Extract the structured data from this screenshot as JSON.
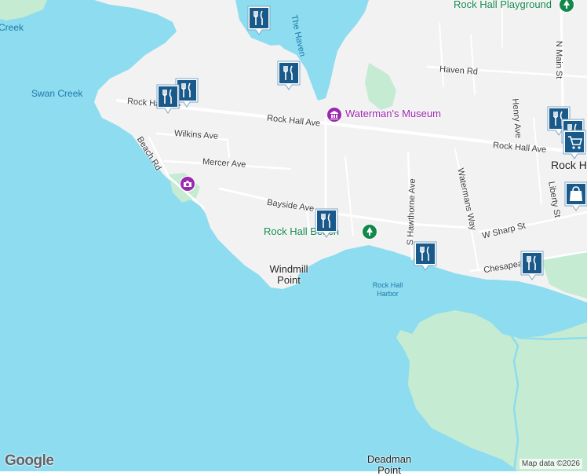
{
  "colors": {
    "water": "#8ddcf0",
    "land": "#f2f2f2",
    "park": "#c5ebd3",
    "road": "#ffffff",
    "pin_fill": "#1a5a8a",
    "pin_border": "#ffffff",
    "poi_purple": "#9c27b0",
    "poi_green": "#13884b"
  },
  "labels": {
    "creek_top": "Creek",
    "swan_creek": "Swan Creek",
    "haven_vertical": "The Haven",
    "playground": "Rock Hall Playground",
    "n_main_st": "N Main St",
    "haven_rd": "Haven Rd",
    "rock_hall_ave_left": "Rock Hall Ave",
    "rock_hall_ave_mid": "Rock Hall Ave",
    "rock_hall_ave_right": "Rock Hall Ave",
    "watermans_museum": "Waterman's Museum",
    "wilkins_ave": "Wilkins Ave",
    "beach_rd": "Beach Rd",
    "mercer_ave": "Mercer Ave",
    "henry_ave": "Henry Ave",
    "rock_hall_town": "Rock Hall",
    "bayside_ave": "Bayside Ave",
    "rock_hall_beach": "Rock Hall Beach",
    "s_hawthorne_ave": "S Hawthorne Ave",
    "watermans_way": "Watermans Way",
    "liberty_st": "Liberty St",
    "w_sharp_st": "W Sharp St",
    "chesapeake": "Chesapeake",
    "windmill_point": "Windmill Point",
    "rock_hall_harbor": "Rock Hall Harbor",
    "deadman_point": "Deadman Point",
    "google": "Google",
    "attribution": "Map data ©2026"
  },
  "markers": [
    {
      "name": "restaurant-pin-top",
      "icon": "fork-knife-icon"
    },
    {
      "name": "restaurant-pin-haven",
      "icon": "fork-knife-icon"
    },
    {
      "name": "restaurant-pin-west-1",
      "icon": "fork-knife-icon"
    },
    {
      "name": "restaurant-pin-west-2",
      "icon": "fork-knife-icon"
    },
    {
      "name": "restaurant-pin-bayside",
      "icon": "fork-knife-icon"
    },
    {
      "name": "restaurant-pin-hawthorne",
      "icon": "fork-knife-icon"
    },
    {
      "name": "restaurant-pin-chesapeake",
      "icon": "fork-knife-icon"
    },
    {
      "name": "restaurant-pin-east-1",
      "icon": "fork-knife-icon"
    },
    {
      "name": "restaurant-pin-east-2",
      "icon": "fork-knife-icon"
    },
    {
      "name": "shopping-pin-east",
      "icon": "shopping-bag-icon"
    },
    {
      "name": "cart-pin-east",
      "icon": "shopping-cart-icon"
    }
  ]
}
